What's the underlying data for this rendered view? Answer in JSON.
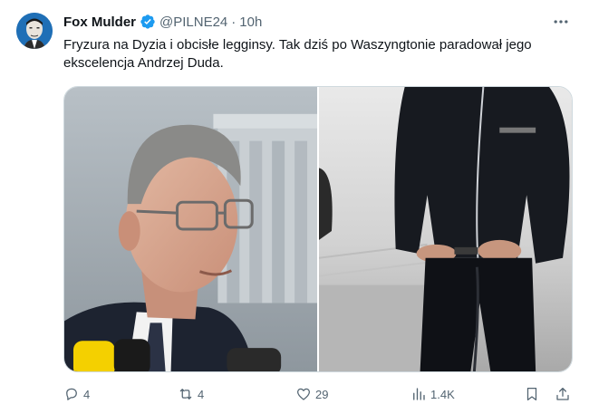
{
  "author": {
    "display_name": "Fox Mulder",
    "handle": "@PILNE24",
    "separator": "·",
    "time": "10h",
    "avatar_icon": "avatar-portrait-icon",
    "verified_icon": "verified-badge-icon"
  },
  "tweet": {
    "text": "Fryzura na Dyzia i obcisłe legginsy. Tak dziś po Waszyngtonie paradował jego ekscelencja Andrzej Duda."
  },
  "media": {
    "count": 2
  },
  "actions": {
    "reply_count": "4",
    "retweet_count": "4",
    "like_count": "29",
    "view_count": "1.4K",
    "icons": [
      "reply-icon",
      "retweet-icon",
      "like-icon",
      "views-icon",
      "bookmark-icon",
      "share-icon"
    ]
  },
  "colors": {
    "text_primary": "#0f1419",
    "text_secondary": "#536471",
    "verified_blue": "#1d9bf0",
    "border": "#cfd9de"
  }
}
